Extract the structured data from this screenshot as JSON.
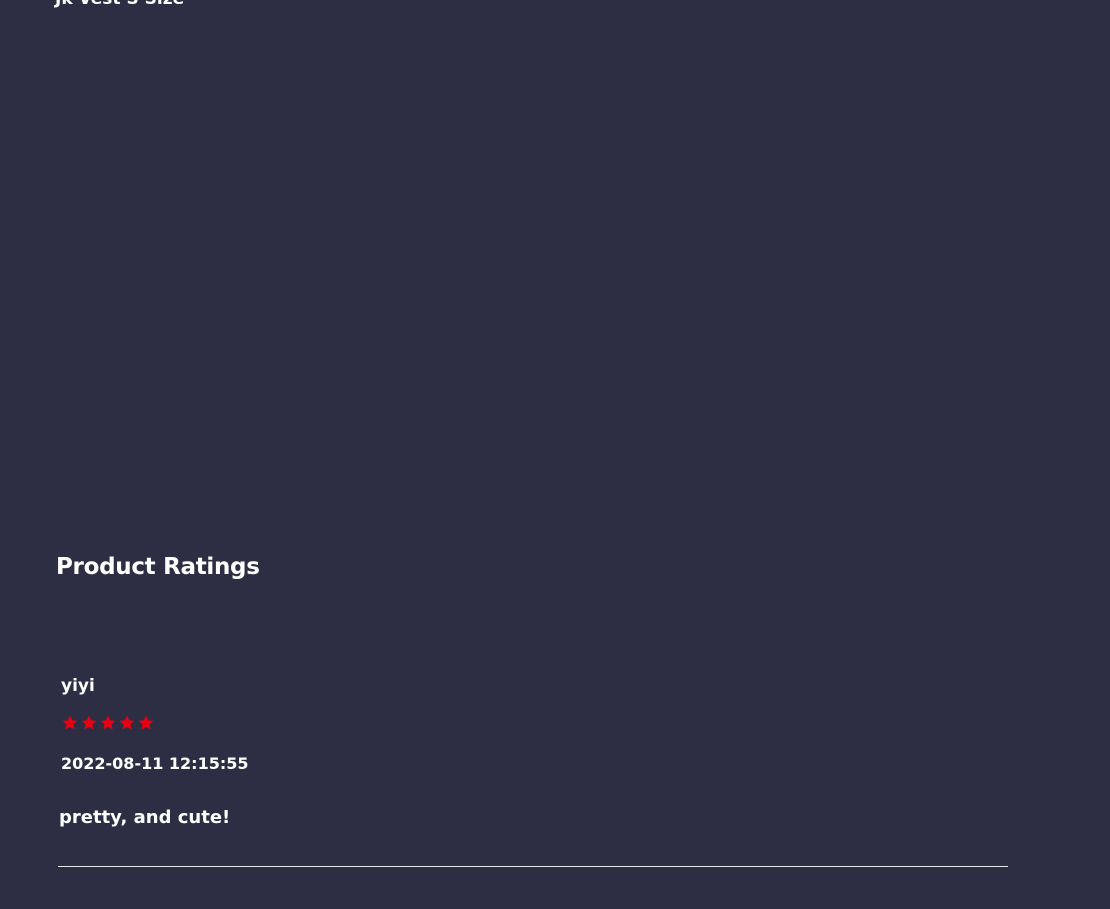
{
  "product": {
    "name": "Jk Vest S Size"
  },
  "ratings_section": {
    "title": "Product Ratings"
  },
  "reviews": [
    {
      "reviewer": "yiyi",
      "rating": 5,
      "max_rating": 5,
      "timestamp": "2022-08-11 12:15:55",
      "text": "pretty, and cute!"
    }
  ],
  "colors": {
    "background": "#2d2e44",
    "text": "#ffffff",
    "star": "#e60012",
    "divider": "#e6e6ea"
  }
}
